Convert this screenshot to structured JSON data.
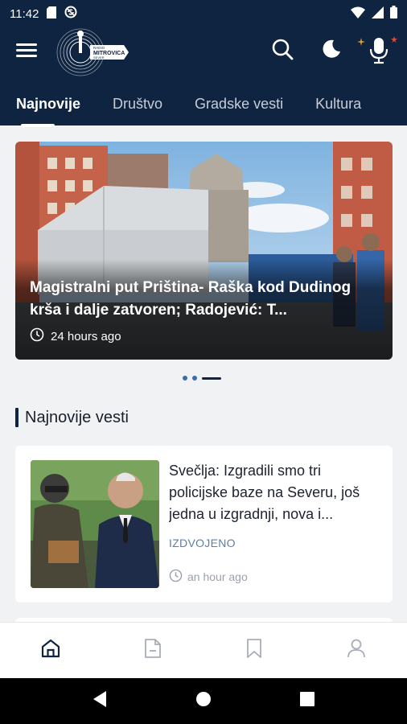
{
  "status_bar": {
    "time": "11:42",
    "icons": [
      "sd-card-icon",
      "no-sync-icon",
      "wifi-icon",
      "signal-icon",
      "battery-icon"
    ]
  },
  "header": {
    "logo_text_top": "RADIO",
    "logo_text_main": "MITROVICA",
    "logo_text_sub": "SEVER",
    "icons": [
      "menu-icon",
      "search-icon",
      "dark-mode-icon",
      "microphone-icon"
    ]
  },
  "tabs": [
    {
      "label": "Najnovije",
      "active": true
    },
    {
      "label": "Društvo",
      "active": false
    },
    {
      "label": "Gradske vesti",
      "active": false
    },
    {
      "label": "Kultura",
      "active": false
    }
  ],
  "carousel": {
    "title": "Magistralni put Priština- Raška kod Dudinog krša i dalje zatvoren; Radojević: T...",
    "time": "24 hours ago",
    "slide_count": 3,
    "active_slide": 3
  },
  "section": {
    "title": "Najnovije vesti"
  },
  "news": [
    {
      "title": "Svečlja: Izgradili smo tri policijske baze na Severu, još jedna u izgradnji, nova i...",
      "category": "IZDVOJENO",
      "time": "an hour ago"
    }
  ],
  "bottom_nav": [
    "home-icon",
    "document-icon",
    "bookmark-icon",
    "profile-icon"
  ],
  "colors": {
    "primary": "#0f2440",
    "accent": "#5a7fa8",
    "background": "#f1f2f4"
  }
}
